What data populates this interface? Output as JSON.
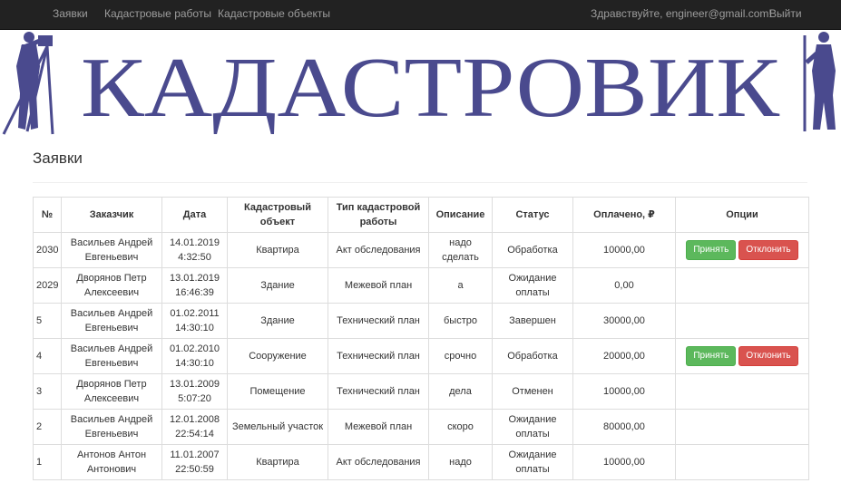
{
  "navbar": {
    "links": [
      "Заявки",
      "Кадастровые работы",
      "Кадастровые объекты"
    ],
    "greeting": "Здравствуйте, engineer@gmail.com!",
    "logout": "Выйти"
  },
  "banner": {
    "logo_text": "КАДАСТРОВИК",
    "color": "#4a4a8e"
  },
  "page": {
    "title": "Заявки"
  },
  "table": {
    "headers": [
      "№",
      "Заказчик",
      "Дата",
      "Кадастровый объект",
      "Тип кадастровой работы",
      "Описание",
      "Статус",
      "Оплачено, ₽",
      "Опции"
    ],
    "rows": [
      {
        "num": "2030",
        "client": [
          "Васильев Андрей",
          "Евгеньевич"
        ],
        "date": [
          "14.01.2019",
          "4:32:50"
        ],
        "object": "Квартира",
        "work": "Акт обследования",
        "desc": "надо сделать",
        "status": [
          "Обработка"
        ],
        "paid": "10000,00",
        "actions": true
      },
      {
        "num": "2029",
        "client": [
          "Дворянов Петр",
          "Алексеевич"
        ],
        "date": [
          "13.01.2019",
          "16:46:39"
        ],
        "object": "Здание",
        "work": "Межевой план",
        "desc": "а",
        "status": [
          "Ожидание",
          "оплаты"
        ],
        "paid": "0,00",
        "actions": false
      },
      {
        "num": "5",
        "client": [
          "Васильев Андрей",
          "Евгеньевич"
        ],
        "date": [
          "01.02.2011",
          "14:30:10"
        ],
        "object": "Здание",
        "work": "Технический план",
        "desc": "быстро",
        "status": [
          "Завершен"
        ],
        "paid": "30000,00",
        "actions": false
      },
      {
        "num": "4",
        "client": [
          "Васильев Андрей",
          "Евгеньевич"
        ],
        "date": [
          "01.02.2010",
          "14:30:10"
        ],
        "object": "Сооружение",
        "work": "Технический план",
        "desc": "срочно",
        "status": [
          "Обработка"
        ],
        "paid": "20000,00",
        "actions": true
      },
      {
        "num": "3",
        "client": [
          "Дворянов Петр",
          "Алексеевич"
        ],
        "date": [
          "13.01.2009",
          "5:07:20"
        ],
        "object": "Помещение",
        "work": "Технический план",
        "desc": "дела",
        "status": [
          "Отменен"
        ],
        "paid": "10000,00",
        "actions": false
      },
      {
        "num": "2",
        "client": [
          "Васильев Андрей",
          "Евгеньевич"
        ],
        "date": [
          "12.01.2008",
          "22:54:14"
        ],
        "object": "Земельный участок",
        "work": "Межевой план",
        "desc": "скоро",
        "status": [
          "Ожидание",
          "оплаты"
        ],
        "paid": "80000,00",
        "actions": false
      },
      {
        "num": "1",
        "client": [
          "Антонов Антон",
          "Антонович"
        ],
        "date": [
          "11.01.2007",
          "22:50:59"
        ],
        "object": "Квартира",
        "work": "Акт обследования",
        "desc": "надо",
        "status": [
          "Ожидание",
          "оплаты"
        ],
        "paid": "10000,00",
        "actions": false
      }
    ],
    "accept_label": "Принять",
    "reject_label": "Отклонить"
  }
}
